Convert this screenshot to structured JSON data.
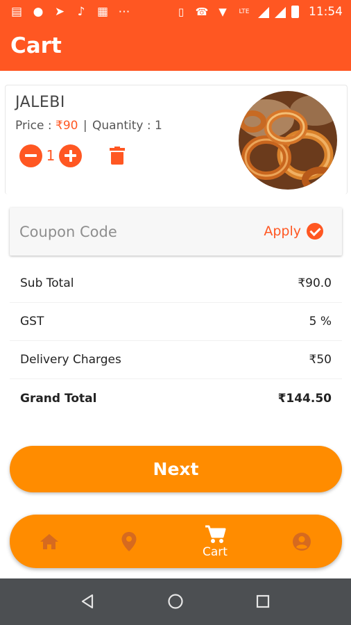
{
  "status_bar": {
    "time": "11:54",
    "lte_label": "LTE",
    "left_icons": [
      "notification-icon",
      "bag-icon",
      "telegram-icon",
      "music-icon",
      "calendar-icon",
      "more-icon"
    ]
  },
  "header": {
    "title": "Cart"
  },
  "cart_item": {
    "name": "JALEBI",
    "price_label": "Price : ",
    "price": "₹90",
    "separator": "|",
    "quantity_label": "Quantity : 1",
    "quantity_value": "1"
  },
  "coupon": {
    "placeholder": "Coupon Code",
    "value": "",
    "apply_label": "Apply"
  },
  "summary": {
    "rows": [
      {
        "label": "Sub Total",
        "value": "₹90.0"
      },
      {
        "label": "GST",
        "value": "5 %"
      },
      {
        "label": "Delivery Charges",
        "value": "₹50"
      },
      {
        "label": "Grand Total",
        "value": "₹144.50"
      }
    ]
  },
  "next_button": {
    "label": "Next"
  },
  "bottom_nav": {
    "cart_label": "Cart",
    "items": [
      "home-icon",
      "location-icon",
      "cart-icon",
      "profile-icon"
    ]
  },
  "colors": {
    "primary": "#ff5722",
    "accent": "#ff8c00",
    "system_nav": "#4c4f52"
  }
}
